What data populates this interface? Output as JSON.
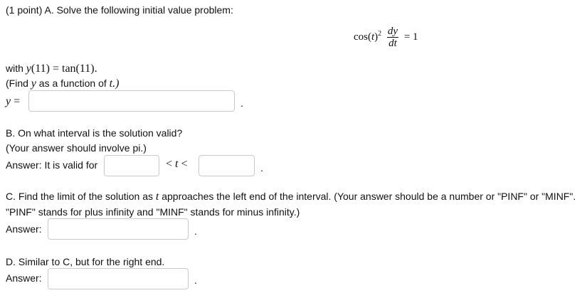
{
  "partA": {
    "header": "(1 point) A. Solve the following initial value problem:",
    "eq": {
      "cos": "cos",
      "t": "t",
      "paren_l": "(",
      "paren_r": ")",
      "sq": "2",
      "dy": "dy",
      "dt": "dt",
      "rhs": "= 1"
    },
    "ic": {
      "prefix": "with",
      "lhs": "y",
      "lhs_arg": "(11) = tan(11)."
    },
    "hint": {
      "before": "(Find",
      "y": "y",
      "mid": "as a function of",
      "t": "t.)"
    },
    "answer_label_var": "y",
    "answer_label_eq": "=",
    "answer_value": "",
    "dot": "."
  },
  "partB": {
    "question": "B. On what interval is the solution valid?",
    "hint": "(Your answer should involve pi.)",
    "answer_label": "Answer: It is valid for",
    "lt1": "<",
    "t": "t",
    "lt2": "<",
    "left_value": "",
    "right_value": "",
    "dot": "."
  },
  "partC": {
    "line1_before": "C. Find the limit of the solution as",
    "line1_var": "t",
    "line1_after": "approaches the left end of the interval. (Your answer should be a number or \"PINF\" or \"MINF\".",
    "line2": "\"PINF\" stands for plus infinity and \"MINF\" stands for minus infinity.)",
    "answer_label": "Answer:",
    "answer_value": "",
    "dot": "."
  },
  "partD": {
    "question": "D. Similar to C, but for the right end.",
    "answer_label": "Answer:",
    "answer_value": "",
    "dot": "."
  }
}
